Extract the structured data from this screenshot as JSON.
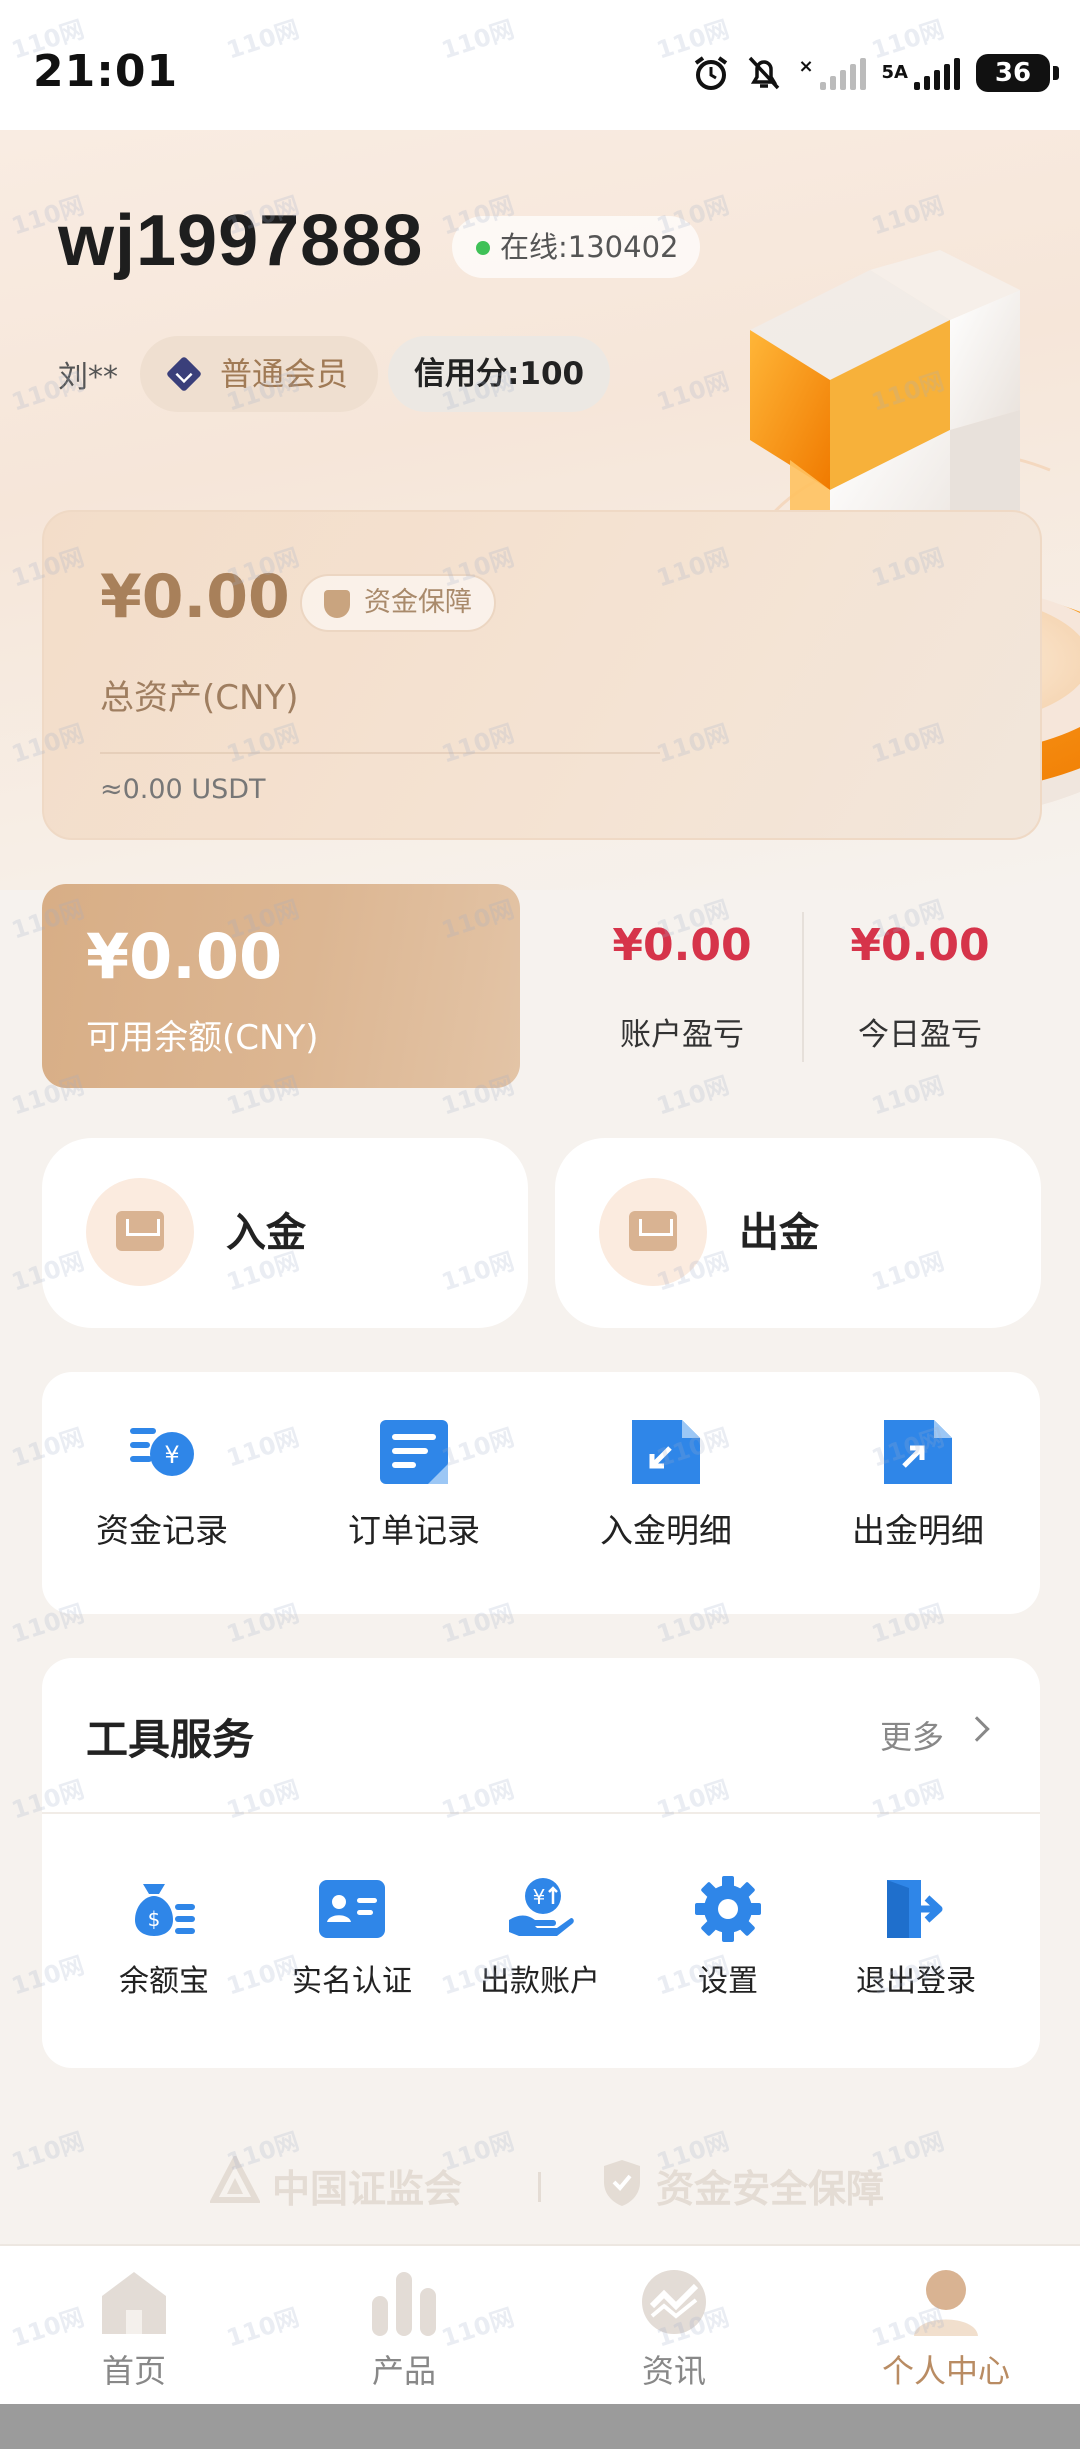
{
  "status_bar": {
    "time": "21:01",
    "network_label": "5A",
    "battery": "36"
  },
  "profile": {
    "username": "wj1997888",
    "online": "在线:130402",
    "realname": "刘**",
    "member_level": "普通会员",
    "credit": "信用分:100"
  },
  "assets": {
    "amount": "¥0.00",
    "guarantee": "资金保障",
    "label": "总资产(CNY)",
    "usdt": "≈0.00 USDT"
  },
  "balance": {
    "amount": "¥0.00",
    "label": "可用余额(CNY)",
    "account_pl_value": "¥0.00",
    "account_pl_label": "账户盈亏",
    "today_pl_value": "¥0.00",
    "today_pl_label": "今日盈亏"
  },
  "actions": {
    "deposit": "入金",
    "withdraw": "出金"
  },
  "records": [
    {
      "label": "资金记录",
      "icon": "fund-record-icon"
    },
    {
      "label": "订单记录",
      "icon": "order-record-icon"
    },
    {
      "label": "入金明细",
      "icon": "deposit-detail-icon"
    },
    {
      "label": "出金明细",
      "icon": "withdraw-detail-icon"
    }
  ],
  "tools": {
    "title": "工具服务",
    "more": "更多",
    "items": [
      {
        "label": "余额宝",
        "icon": "money-bag-icon"
      },
      {
        "label": "实名认证",
        "icon": "id-card-icon"
      },
      {
        "label": "出款账户",
        "icon": "payout-account-icon"
      },
      {
        "label": "设置",
        "icon": "gear-icon"
      },
      {
        "label": "退出登录",
        "icon": "logout-icon"
      }
    ]
  },
  "footer": {
    "left": "中国证监会",
    "right": "资金安全保障"
  },
  "nav": [
    {
      "label": "首页",
      "icon": "home-icon"
    },
    {
      "label": "产品",
      "icon": "bar-chart-icon"
    },
    {
      "label": "资讯",
      "icon": "news-icon"
    },
    {
      "label": "个人中心",
      "icon": "user-icon"
    }
  ],
  "colors": {
    "accent": "#b98c63",
    "profit_loss": "#d6344a",
    "icon_blue": "#2f86e8",
    "online": "#3fc157"
  },
  "watermark": "110网"
}
